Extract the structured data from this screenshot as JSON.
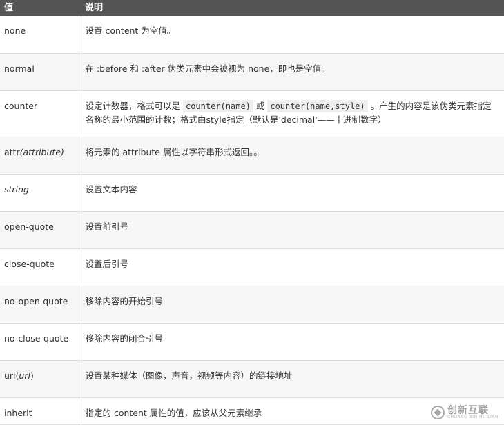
{
  "table": {
    "headers": [
      "值",
      "说明"
    ],
    "rows": [
      {
        "value": "none",
        "desc_pre": "设置 content 为空值。"
      },
      {
        "value": "normal",
        "desc_pre": "在 :before 和 :after 伪类元素中会被视为 none，即也是空值。"
      },
      {
        "value": "counter",
        "desc_pre": "设定计数器，格式可以是 ",
        "code1": "counter(name)",
        "desc_mid": " 或 ",
        "code2": "counter(name,style)",
        "desc_post": " 。产生的内容是该伪类元素指定名称的最小范围的计数；格式由style指定（默认是'decimal'——十进制数字）"
      },
      {
        "value": "attr",
        "value_italic": "(attribute)",
        "desc_pre": "将元素的 attribute 属性以字符串形式返回。。"
      },
      {
        "value_italic": "string",
        "desc_pre": "设置文本内容"
      },
      {
        "value": "open-quote",
        "desc_pre": "设置前引号"
      },
      {
        "value": "close-quote",
        "desc_pre": "设置后引号"
      },
      {
        "value": "no-open-quote",
        "desc_pre": "移除内容的开始引号"
      },
      {
        "value": "no-close-quote",
        "desc_pre": "移除内容的闭合引号"
      },
      {
        "value": "url(",
        "value_italic": "url",
        "value_suffix": ")",
        "desc_pre": "设置某种媒体（图像，声音，视频等内容）的链接地址"
      },
      {
        "value": "inherit",
        "desc_pre": "指定的 content 属性的值，应该从父元素继承"
      }
    ]
  },
  "watermark": {
    "cn": "创新互联",
    "en": "CHUANG XIN HU LIAN"
  }
}
